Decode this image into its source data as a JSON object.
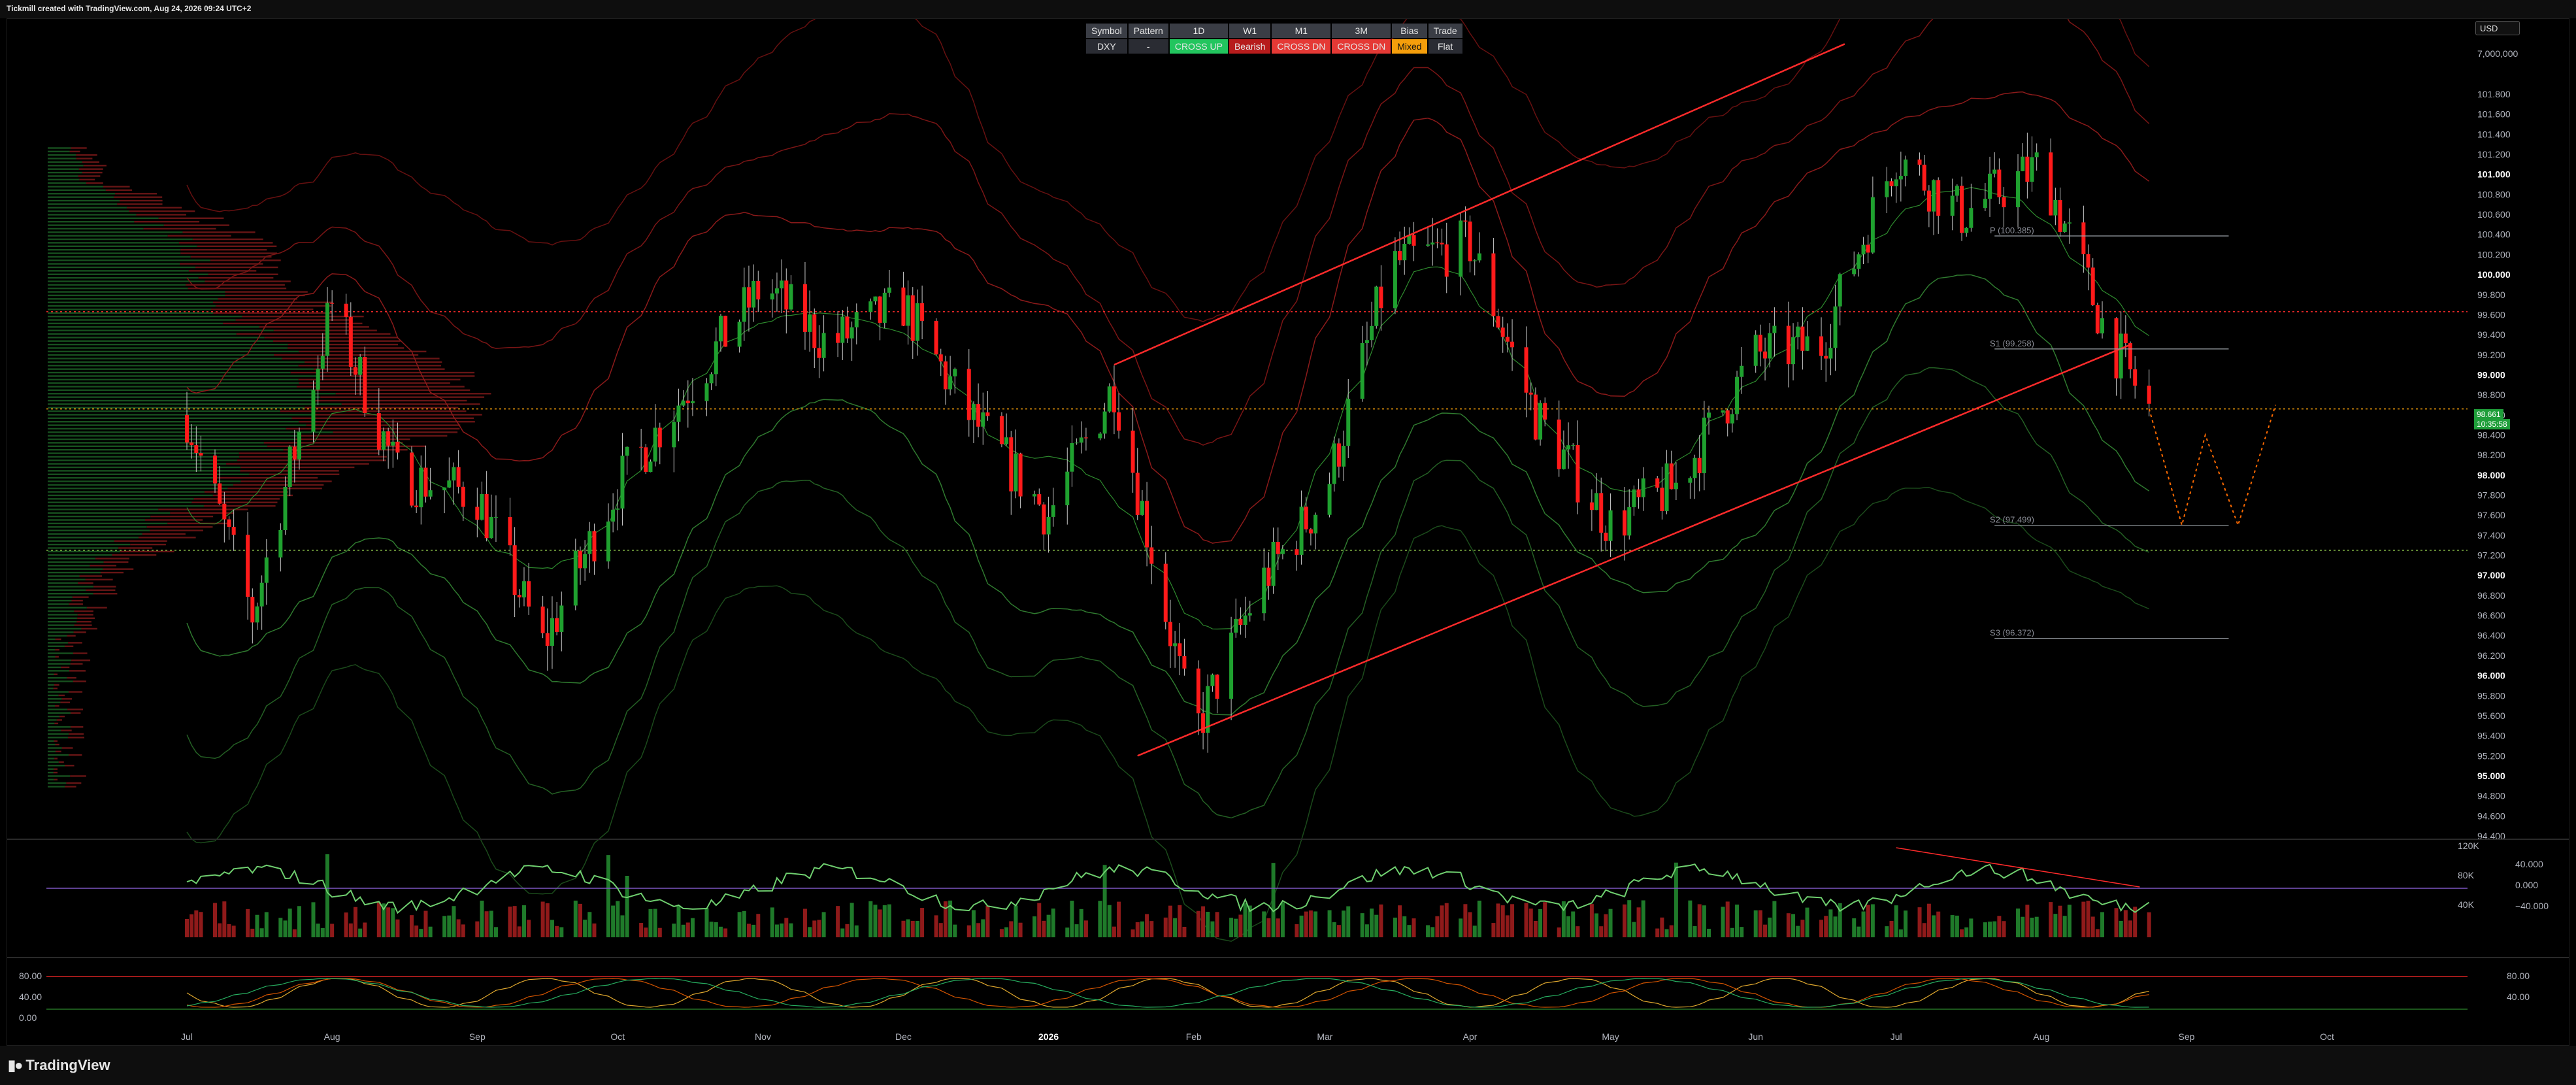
{
  "header": {
    "credit": "Tickmill created with TradingView.com, Aug 24, 2026 09:24 UTC+2"
  },
  "currency": "USD",
  "bias_table": {
    "headers": [
      "Symbol",
      "Pattern",
      "1D",
      "W1",
      "M1",
      "3M",
      "Bias",
      "Trade"
    ],
    "values": [
      "DXY",
      "-",
      "CROSS UP",
      "Bearish",
      "CROSS DN",
      "CROSS DN",
      "Mixed",
      "Flat"
    ],
    "value_colors": [
      "#2a2c33",
      "#2a2c33",
      "#22c55e",
      "#b71c1c",
      "#e53935",
      "#e53935",
      "#f59e0b",
      "#2a2c33"
    ]
  },
  "price_axis": {
    "top_label": "7,000,000",
    "ticks": [
      "101.800",
      "101.600",
      "101.400",
      "101.200",
      "101.000",
      "100.800",
      "100.600",
      "100.400",
      "100.200",
      "100.000",
      "99.800",
      "99.600",
      "99.400",
      "99.200",
      "99.000",
      "98.800",
      "98.600",
      "98.400",
      "98.200",
      "98.000",
      "97.800",
      "97.600",
      "97.400",
      "97.200",
      "97.000",
      "96.800",
      "96.600",
      "96.400",
      "96.200",
      "96.000",
      "95.800",
      "95.600",
      "95.400",
      "95.200",
      "95.000",
      "94.800",
      "94.600",
      "94.400"
    ],
    "current_price": "98.661",
    "countdown": "10:35:58"
  },
  "pivot_labels": [
    "P (100.385)",
    "S1 (99.258)",
    "S2 (97.499)",
    "S3 (96.372)"
  ],
  "volume_axis": [
    "120K",
    "80K",
    "40K"
  ],
  "rsi_axis": [
    "40.000",
    "0.000",
    "−40.000"
  ],
  "stoch_axis_left": [
    "80.00",
    "40.00",
    "0.00"
  ],
  "stoch_axis_right": [
    "80.00",
    "40.00"
  ],
  "time_axis": [
    "Jul",
    "Aug",
    "Sep",
    "Oct",
    "Nov",
    "Dec",
    "2026",
    "Feb",
    "Mar",
    "Apr",
    "May",
    "Jun",
    "Jul",
    "Aug",
    "Sep",
    "Oct"
  ],
  "footer": {
    "logo": "TradingView"
  },
  "colors": {
    "bull": "#1fa12f",
    "bear": "#ff1a1a",
    "background": "#000000",
    "channel": "#ff2b2b"
  },
  "chart_data": {
    "type": "line",
    "title": "",
    "symbol": "DXY",
    "xlabel": "",
    "ylabel": "",
    "ylim": [
      94.4,
      101.8
    ],
    "x": [
      "2025-07-01",
      "2025-07-15",
      "2025-08-01",
      "2025-08-15",
      "2025-09-01",
      "2025-09-15",
      "2025-10-01",
      "2025-10-15",
      "2025-11-01",
      "2025-11-15",
      "2025-12-01",
      "2025-12-15",
      "2026-01-01",
      "2026-01-15",
      "2026-02-01",
      "2026-02-15",
      "2026-03-01",
      "2026-03-15",
      "2026-04-01",
      "2026-04-15",
      "2026-05-01",
      "2026-05-15",
      "2026-06-01",
      "2026-06-15",
      "2026-07-01",
      "2026-07-15",
      "2026-08-01",
      "2026-08-15",
      "2026-08-24"
    ],
    "series": [
      {
        "values": [
          98.6,
          96.6,
          99.7,
          98.0,
          97.8,
          96.3,
          97.9,
          98.8,
          99.9,
          99.3,
          99.7,
          98.6,
          97.6,
          98.9,
          95.4,
          96.9,
          97.8,
          100.1,
          100.3,
          98.6,
          97.5,
          97.9,
          99.2,
          99.3,
          101.2,
          100.6,
          101.1,
          99.4,
          98.66
        ]
      }
    ],
    "key_levels": [
      99.63,
      98.66,
      97.25
    ],
    "pivots": {
      "P": 100.385,
      "S1": 99.258,
      "S2": 97.499,
      "S3": 96.372
    },
    "channel": {
      "upper": [
        [
          "2026-01-15",
          99.1
        ],
        [
          "2026-06-20",
          102.3
        ]
      ],
      "lower": [
        [
          "2026-01-20",
          95.2
        ],
        [
          "2026-08-20",
          99.3
        ]
      ]
    },
    "grid": false
  }
}
